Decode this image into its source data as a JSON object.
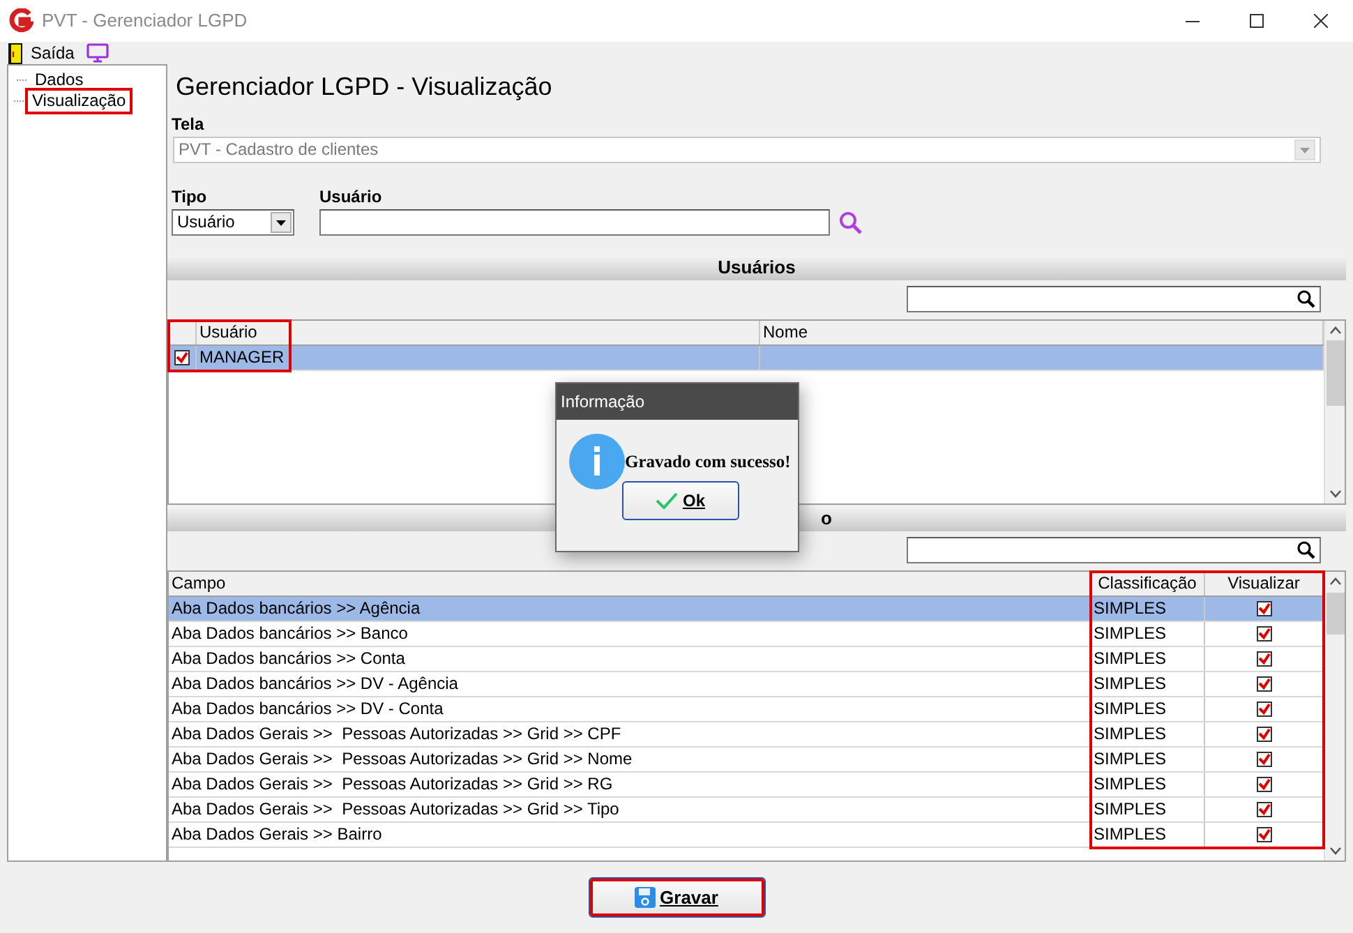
{
  "window": {
    "title": "PVT - Gerenciador LGPD"
  },
  "menu": [
    {
      "label": "Saída",
      "kind": "exit"
    },
    {
      "kind": "monitor"
    }
  ],
  "tree": [
    {
      "label": "Dados",
      "highlighted": false
    },
    {
      "label": "Visualização",
      "highlighted": true
    }
  ],
  "heading": "Gerenciador LGPD - Visualização",
  "tela": {
    "label": "Tela",
    "value": "PVT - Cadastro de clientes",
    "disabled": true
  },
  "tipo": {
    "label": "Tipo",
    "value": "Usuário"
  },
  "usuario": {
    "label": "Usuário"
  },
  "users_section": {
    "title": "Usuários",
    "columns": [
      {
        "highlighted": true
      },
      {
        "label": "Usuário",
        "highlighted": true
      },
      {
        "label": "Nome",
        "highlighted": false
      }
    ],
    "rows": [
      {
        "checked": true,
        "usuario": "MANAGER",
        "nome": "",
        "selected": true
      }
    ]
  },
  "fields_section": {
    "title": "o",
    "columns": [
      {
        "label": "Campo",
        "highlighted": false
      },
      {
        "label": "Classificação",
        "highlighted": true
      },
      {
        "label": "Visualizar",
        "highlighted": true
      }
    ],
    "rows": [
      {
        "campo": "Aba Dados bancários >> Agência",
        "classificacao": "SIMPLES",
        "checked": true,
        "selected": true
      },
      {
        "campo": "Aba Dados bancários >> Banco",
        "classificacao": "SIMPLES",
        "checked": true,
        "selected": false
      },
      {
        "campo": "Aba Dados bancários >> Conta",
        "classificacao": "SIMPLES",
        "checked": true,
        "selected": false
      },
      {
        "campo": "Aba Dados bancários >> DV - Agência",
        "classificacao": "SIMPLES",
        "checked": true,
        "selected": false
      },
      {
        "campo": "Aba Dados bancários >> DV - Conta",
        "classificacao": "SIMPLES",
        "checked": true,
        "selected": false
      },
      {
        "campo": "Aba Dados Gerais >>  Pessoas Autorizadas >> Grid >> CPF",
        "classificacao": "SIMPLES",
        "checked": true,
        "selected": false
      },
      {
        "campo": "Aba Dados Gerais >>  Pessoas Autorizadas >> Grid >> Nome",
        "classificacao": "SIMPLES",
        "checked": true,
        "selected": false
      },
      {
        "campo": "Aba Dados Gerais >>  Pessoas Autorizadas >> Grid >> RG",
        "classificacao": "SIMPLES",
        "checked": true,
        "selected": false
      },
      {
        "campo": "Aba Dados Gerais >>  Pessoas Autorizadas >> Grid >> Tipo",
        "classificacao": "SIMPLES",
        "checked": true,
        "selected": false
      },
      {
        "campo": "Aba Dados Gerais >> Bairro",
        "classificacao": "SIMPLES",
        "checked": true,
        "selected": false
      }
    ]
  },
  "save_button": {
    "label": "Gravar",
    "highlighted": true
  },
  "dialog": {
    "title": "Informação",
    "message": "Gravado com sucesso!",
    "button": "Ok"
  }
}
